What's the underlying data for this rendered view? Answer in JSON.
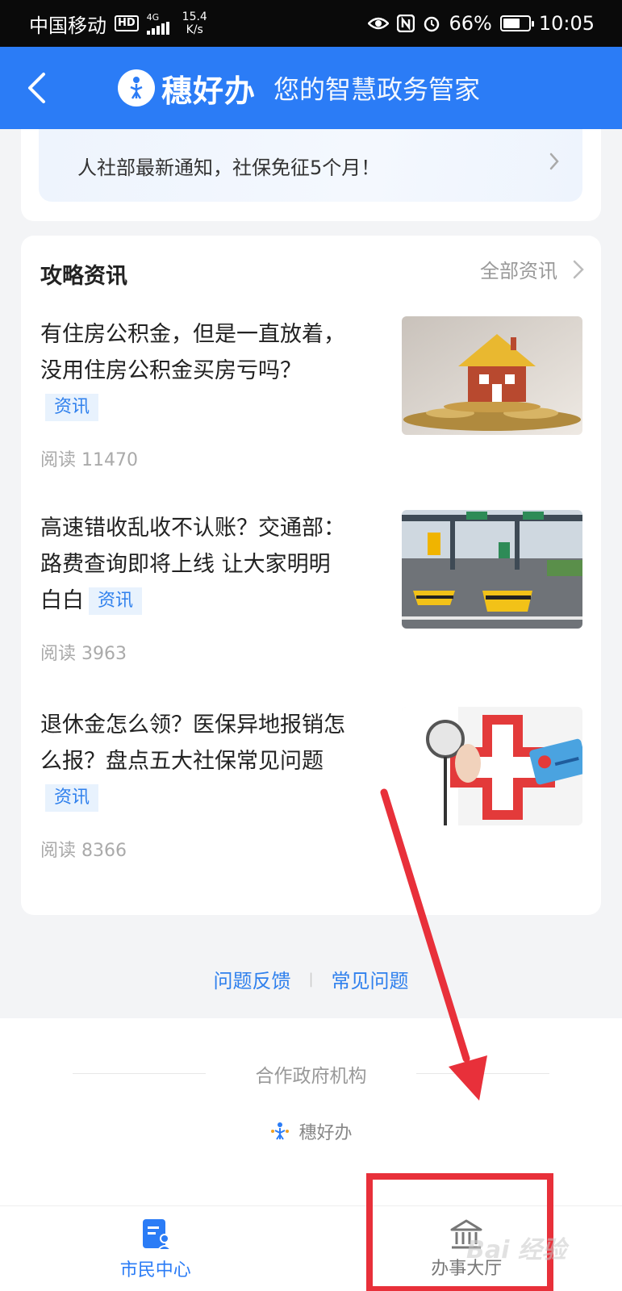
{
  "status_bar": {
    "carrier": "中国移动",
    "hd": "HD",
    "network": "4G",
    "speed_value": "15.4",
    "speed_unit": "K/s",
    "battery": "66%",
    "battery_level": 0.66,
    "time": "10:05"
  },
  "header": {
    "brand_name": "穗好办",
    "slogan": "您的智慧政务管家"
  },
  "notice": {
    "text": "人社部最新通知，社保免征5个月！"
  },
  "news": {
    "title": "攻略资讯",
    "all_label": "全部资讯",
    "articles": [
      {
        "title": "有住房公积金，但是一直放着，没用住房公积金买房亏吗？",
        "tag": "资讯",
        "reads": "阅读 11470",
        "image": "house-on-coins"
      },
      {
        "title": "高速错收乱收不认账？交通部：路费查询即将上线 让大家明明白白",
        "tag": "资讯",
        "reads": "阅读 3963",
        "image": "highway-toll-station"
      },
      {
        "title": "退休金怎么领？医保异地报销怎么报？盘点五大社保常见问题",
        "tag": "资讯",
        "reads": "阅读 8366",
        "image": "doctor-stethoscope-medical-card"
      }
    ]
  },
  "links": {
    "feedback": "问题反馈",
    "faq": "常见问题"
  },
  "partner": {
    "title": "合作政府机构",
    "org_name": "穗好办"
  },
  "tabbar": {
    "tabs": [
      {
        "label": "市民中心",
        "icon": "citizen-card-icon",
        "active": true
      },
      {
        "label": "办事大厅",
        "icon": "government-hall-icon",
        "active": false
      }
    ]
  },
  "colors": {
    "primary": "#2b7cf6",
    "annotation_red": "#e8303a",
    "tag_bg": "#e8f2fd",
    "tag_text": "#2f80ed"
  }
}
